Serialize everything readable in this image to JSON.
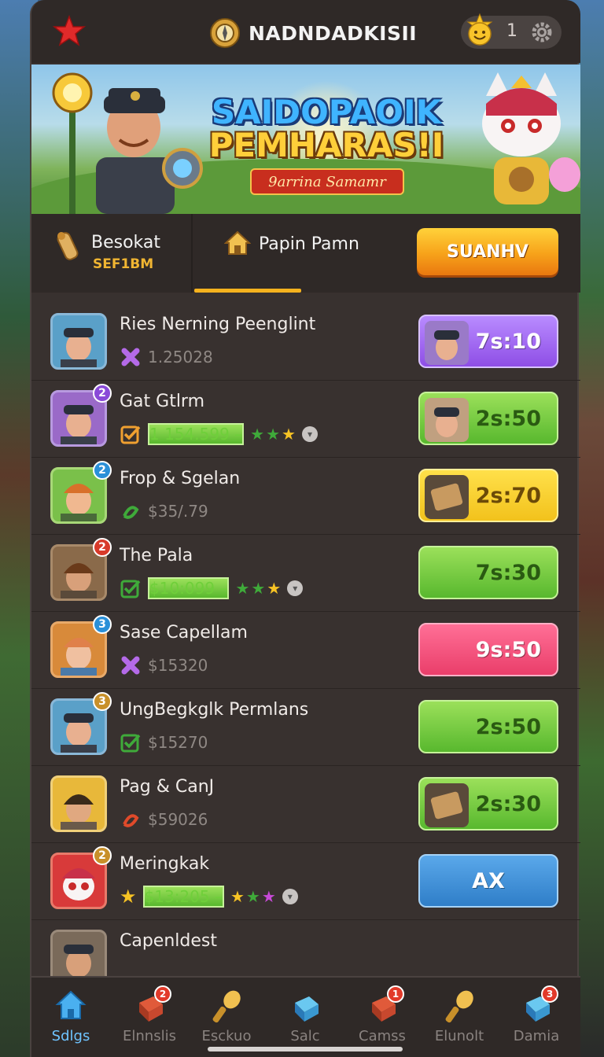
{
  "header": {
    "title": "NADNDADKISII",
    "coin_count": "1",
    "icons": [
      "star-icon",
      "compass-icon",
      "smiley-icon",
      "gear-icon"
    ]
  },
  "banner": {
    "title_line1": "SAIDOPAOIK",
    "title_line2": "PEMHARAS!I",
    "ribbon": "9arrina Samamr"
  },
  "tabs": {
    "tab1_label": "Besokat",
    "tab1_sub": "SEF1BM",
    "tab2_label": "Papin Pamn",
    "action_label": "SUANHV"
  },
  "rows": [
    {
      "title": "Ries Nerning Peenglint",
      "value": "1.25028",
      "badge": "",
      "timer": "7s:10",
      "color": "purple"
    },
    {
      "title": "Gat Gtlrm",
      "value": "1 154.599 –",
      "badge": "2",
      "timer": "2s:50",
      "color": "green"
    },
    {
      "title": "Frop & Sgelan",
      "value": "$35/.79",
      "badge": "2",
      "timer": "2s:70",
      "color": "yellow"
    },
    {
      "title": "The Pala",
      "value": "$10:099 –",
      "badge": "2",
      "timer": "7s:30",
      "color": "green"
    },
    {
      "title": "Sase Capellam",
      "value": "$15320",
      "badge": "3",
      "timer": "9s:50",
      "color": "pink"
    },
    {
      "title": "UngBegkglk Permlans",
      "value": "$15270",
      "badge": "3",
      "timer": "2s:50",
      "color": "green"
    },
    {
      "title": "Pag & CanJ",
      "value": "$59026",
      "badge": "",
      "timer": "2s:30",
      "color": "green"
    },
    {
      "title": "Meringkak",
      "value": "$13:205 –",
      "badge": "2",
      "timer": "AX",
      "color": "blue"
    },
    {
      "title": "Capenldest",
      "value": "",
      "badge": "",
      "timer": "",
      "color": ""
    }
  ],
  "bottom_nav": [
    {
      "label": "Sdlgs",
      "badge": "",
      "active": true
    },
    {
      "label": "Elnnslis",
      "badge": "2",
      "active": false
    },
    {
      "label": "Esckuo",
      "badge": "",
      "active": false
    },
    {
      "label": "Salc",
      "badge": "",
      "active": false
    },
    {
      "label": "Camss",
      "badge": "1",
      "active": false
    },
    {
      "label": "Elunolt",
      "badge": "",
      "active": false
    },
    {
      "label": "Damia",
      "badge": "3",
      "active": false
    }
  ],
  "colors": {
    "accent": "#f5b21e",
    "panel": "#38312f",
    "active_nav": "#6fc4ff"
  }
}
